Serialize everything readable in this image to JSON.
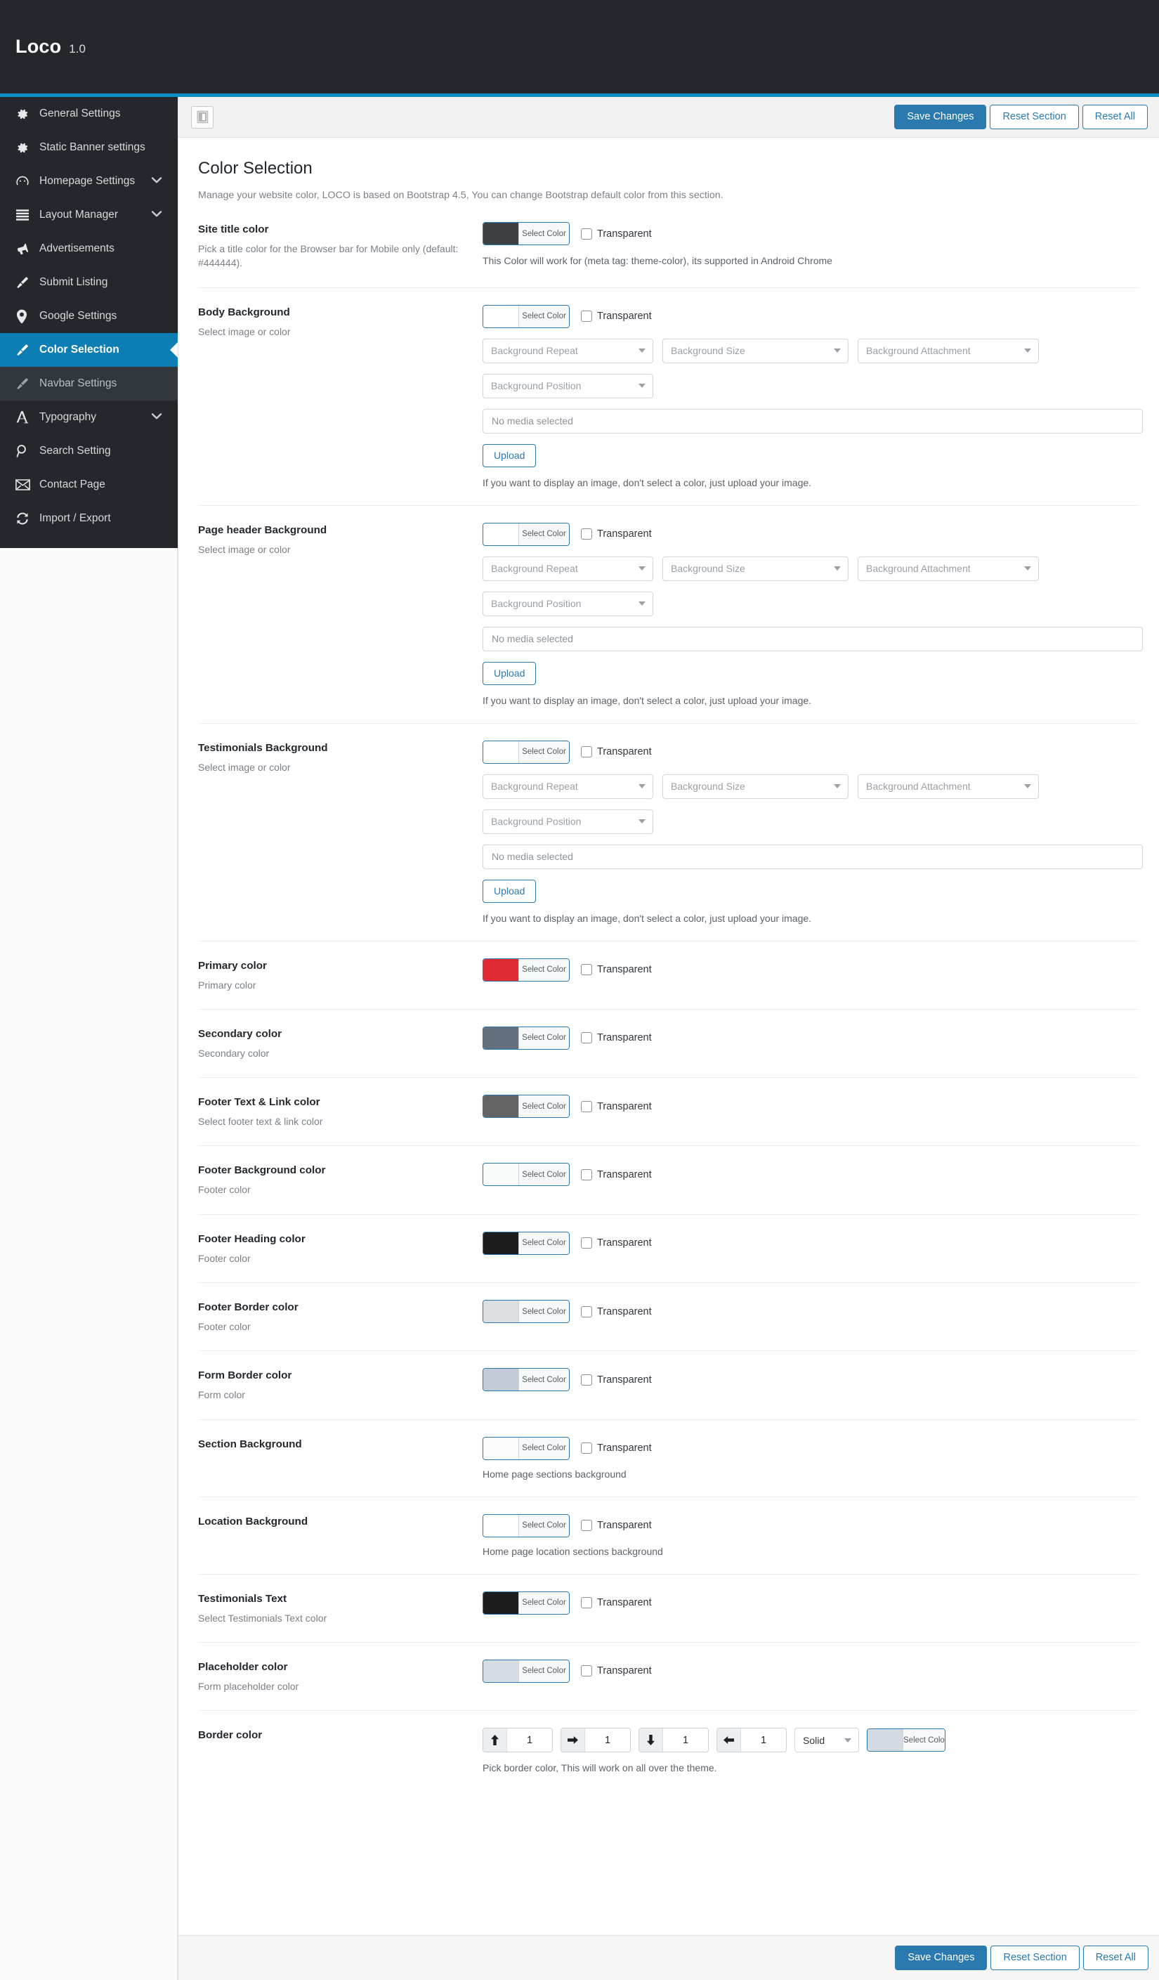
{
  "brand": {
    "name": "Loco",
    "version": "1.0"
  },
  "colors": {
    "accent": "#0d8ec4",
    "sidebar_bg": "#24282c",
    "active_item": "#0d7eb4",
    "primary_button": "#2a7ab0"
  },
  "sidebar": {
    "items": [
      {
        "label": "General Settings",
        "icon": "gear-icon",
        "chevron": false,
        "active": false,
        "sub": false
      },
      {
        "label": "Static Banner settings",
        "icon": "gear-icon",
        "chevron": false,
        "active": false,
        "sub": false
      },
      {
        "label": "Homepage Settings",
        "icon": "speedometer-icon",
        "chevron": true,
        "active": false,
        "sub": false
      },
      {
        "label": "Layout Manager",
        "icon": "list-icon",
        "chevron": true,
        "active": false,
        "sub": false
      },
      {
        "label": "Advertisements",
        "icon": "megaphone-icon",
        "chevron": false,
        "active": false,
        "sub": false
      },
      {
        "label": "Submit Listing",
        "icon": "brush-icon",
        "chevron": false,
        "active": false,
        "sub": false
      },
      {
        "label": "Google Settings",
        "icon": "map-pin-icon",
        "chevron": false,
        "active": false,
        "sub": false
      },
      {
        "label": "Color Selection",
        "icon": "brush-icon",
        "chevron": false,
        "active": true,
        "sub": false
      },
      {
        "label": "Navbar Settings",
        "icon": "brush-icon",
        "chevron": false,
        "active": false,
        "sub": true
      },
      {
        "label": "Typography",
        "icon": "type-a-icon",
        "chevron": true,
        "active": false,
        "sub": false
      },
      {
        "label": "Search Setting",
        "icon": "search-icon",
        "chevron": false,
        "active": false,
        "sub": false
      },
      {
        "label": "Contact Page",
        "icon": "envelope-icon",
        "chevron": false,
        "active": false,
        "sub": false
      },
      {
        "label": "Import / Export",
        "icon": "refresh-icon",
        "chevron": false,
        "active": false,
        "sub": false
      }
    ]
  },
  "toolbar": {
    "layout_toggle_icon": "layout-panel-icon",
    "save_label": "Save Changes",
    "reset_section_label": "Reset Section",
    "reset_all_label": "Reset All"
  },
  "main": {
    "title": "Color Selection",
    "subtitle": "Manage your website color, LOCO is based on Bootstrap 4.5, You can change Bootstrap default color from this section.",
    "select_color_label": "Select Color",
    "transparent_label": "Transparent",
    "upload_label": "Upload",
    "media_placeholder": "No media selected",
    "image_hint": "If you want to display an image, don't select a color, just upload your image.",
    "bg_selects": [
      "Background Repeat",
      "Background Size",
      "Background Attachment",
      "Background Position"
    ],
    "fields": [
      {
        "title": "Site title color",
        "desc": "Pick a title color for the Browser bar for Mobile only (default: #444444).",
        "swatch": "#3c4043",
        "hint": "This Color will work for (meta tag: theme-color), its supported in Android Chrome",
        "type": "color"
      },
      {
        "title": "Body Background",
        "desc": "Select image or color",
        "swatch": "#ffffff",
        "hint": "If you want to display an image, don't select a color, just upload your image.",
        "type": "background"
      },
      {
        "title": "Page header Background",
        "desc": "Select image or color",
        "swatch": "#ffffff",
        "hint": "If you want to display an image, don't select a color, just upload your image.",
        "type": "background"
      },
      {
        "title": "Testimonials Background",
        "desc": "Select image or color",
        "swatch": "#ffffff",
        "hint": "If you want to display an image, don't select a color, just upload your image.",
        "type": "background"
      },
      {
        "title": "Primary color",
        "desc": "Primary color",
        "swatch": "#e02b32",
        "hint": "",
        "type": "color"
      },
      {
        "title": "Secondary color",
        "desc": "Secondary color",
        "swatch": "#636f7d",
        "hint": "",
        "type": "color"
      },
      {
        "title": "Footer Text & Link color",
        "desc": "Select footer text & link color",
        "swatch": "#646464",
        "hint": "",
        "type": "color"
      },
      {
        "title": "Footer Background color",
        "desc": "Footer color",
        "swatch": "#fafbfb",
        "hint": "",
        "type": "color"
      },
      {
        "title": "Footer Heading color",
        "desc": "Footer color",
        "swatch": "#1d1d1d",
        "hint": "",
        "type": "color"
      },
      {
        "title": "Footer Border color",
        "desc": "Footer color",
        "swatch": "#dcdfe1",
        "hint": "",
        "type": "color"
      },
      {
        "title": "Form Border color",
        "desc": "Form color",
        "swatch": "#c3cbd6",
        "hint": "",
        "type": "color"
      },
      {
        "title": "Section Background",
        "desc": "",
        "swatch": "#fcfcfc",
        "hint": "Home page sections background",
        "type": "color"
      },
      {
        "title": "Location Background",
        "desc": "",
        "swatch": "#ffffff",
        "hint": "Home page location sections background",
        "type": "color"
      },
      {
        "title": "Testimonials Text",
        "desc": "Select Testimonials Text color",
        "swatch": "#1d1d1d",
        "hint": "",
        "type": "color"
      },
      {
        "title": "Placeholder color",
        "desc": "Form placeholder color",
        "swatch": "#d6dce3",
        "hint": "",
        "type": "color"
      }
    ],
    "border_field": {
      "title": "Border color",
      "hint": "Pick border color, This will work on all over the theme.",
      "spinners": [
        {
          "direction": "up",
          "value": "1"
        },
        {
          "direction": "right",
          "value": "1"
        },
        {
          "direction": "down",
          "value": "1"
        },
        {
          "direction": "left",
          "value": "1"
        }
      ],
      "style_value": "Solid",
      "swatch": "#d3dae1"
    }
  }
}
